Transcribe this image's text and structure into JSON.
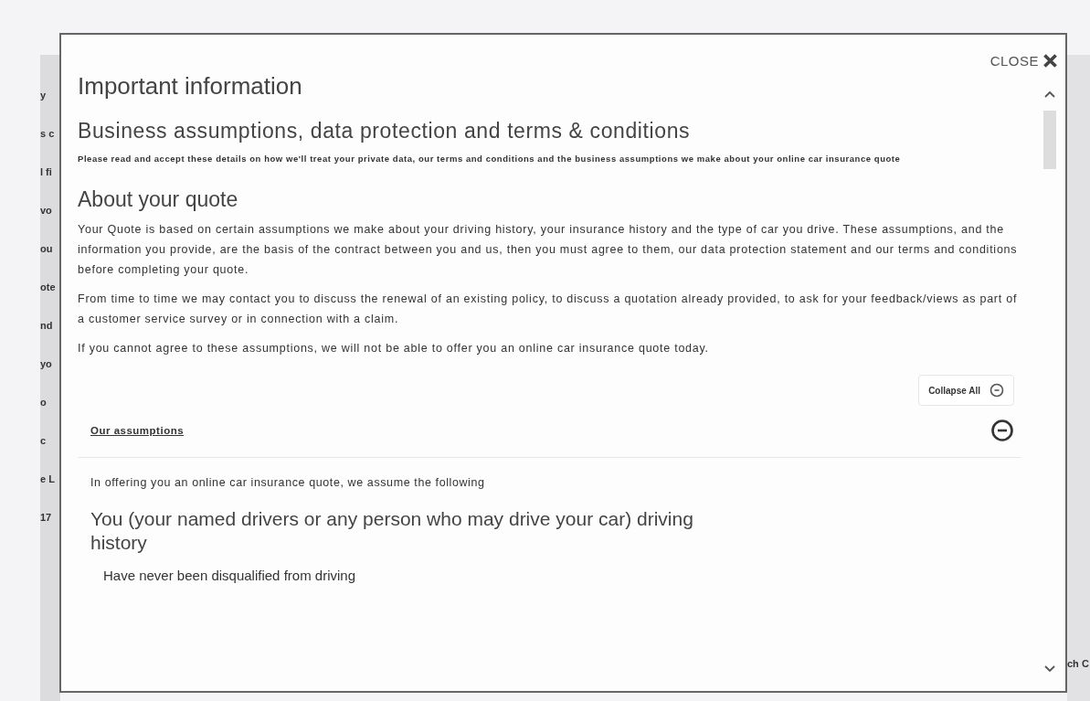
{
  "background_page": {
    "left_fragments": [
      "y",
      "s c",
      "l fi",
      "vo",
      "ou",
      "ote",
      "nd",
      "yo",
      "o",
      "c",
      "e L",
      "17"
    ],
    "right_fragments": [
      "ch C"
    ]
  },
  "modal": {
    "close_label": "CLOSE",
    "title": "Important information",
    "subtitle": "Business assumptions, data protection and terms & conditions",
    "intro": "Please read and accept these details on how we'll treat your private data, our terms and conditions and the business assumptions we make about your online car insurance quote",
    "section_heading": "About your quote",
    "paragraphs": [
      "Your Quote is based on certain assumptions we make about your driving history, your insurance history and the type of car you drive. These assumptions, and the information you provide, are the basis of the contract between you and us, then you must agree to them, our data protection statement and our terms and conditions before completing your quote.",
      "From time to time we may contact you to discuss the renewal of an existing policy, to discuss a quotation already provided, to ask for your feedback/views as part of a customer service survey or in connection with a claim.",
      "If you cannot agree to these assumptions, we will not be able to offer you an online car insurance quote today."
    ],
    "collapse_all_label": "Collapse All",
    "accordion": {
      "title": "Our assumptions",
      "expanded": true,
      "lead": "In offering you an online car insurance quote, we assume the following",
      "group_heading": "You (your named drivers or any person who may drive your car) driving history",
      "items": [
        "Have never been disqualified from driving"
      ]
    }
  }
}
